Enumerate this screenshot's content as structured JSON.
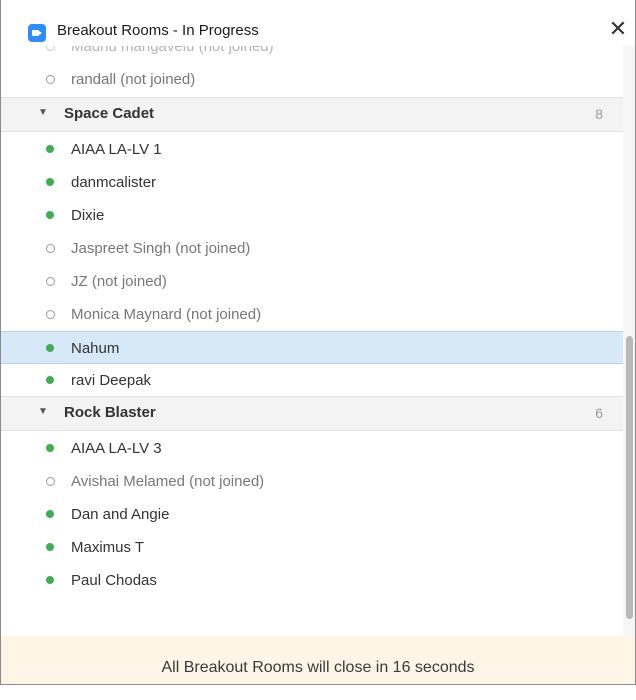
{
  "window": {
    "title": "Breakout Rooms - In Progress",
    "close_glyph": "✕"
  },
  "top_partial": [
    {
      "name": "Madhu mangavelu (not joined)",
      "status": "notjoined"
    },
    {
      "name": "randall (not joined)",
      "status": "notjoined"
    }
  ],
  "rooms": [
    {
      "name": "Space Cadet",
      "count": "8",
      "members": [
        {
          "name": "AIAA LA-LV 1",
          "status": "joined"
        },
        {
          "name": "danmcalister",
          "status": "joined"
        },
        {
          "name": "Dixie",
          "status": "joined"
        },
        {
          "name": "Jaspreet Singh (not joined)",
          "status": "notjoined"
        },
        {
          "name": "JZ (not joined)",
          "status": "notjoined"
        },
        {
          "name": "Monica Maynard (not joined)",
          "status": "notjoined"
        },
        {
          "name": "Nahum",
          "status": "joined",
          "selected": true
        },
        {
          "name": "ravi Deepak",
          "status": "joined"
        }
      ]
    },
    {
      "name": "Rock Blaster",
      "count": "6",
      "members": [
        {
          "name": "AIAA LA-LV 3",
          "status": "joined"
        },
        {
          "name": "Avishai Melamed (not joined)",
          "status": "notjoined"
        },
        {
          "name": "Dan and Angie",
          "status": "joined"
        },
        {
          "name": "Maximus T",
          "status": "joined"
        },
        {
          "name": "Paul Chodas",
          "status": "joined"
        }
      ]
    }
  ],
  "footer": {
    "message": "All Breakout Rooms will close in 16 seconds"
  },
  "colors": {
    "joined": "#3fae52",
    "selected": "#d7e8f7",
    "footer_bg": "#fff5e7",
    "zoom_blue": "#2d8cff"
  },
  "icons": {
    "app": "zoom-app-icon",
    "close": "close-icon",
    "caret": "caret-down-icon"
  }
}
